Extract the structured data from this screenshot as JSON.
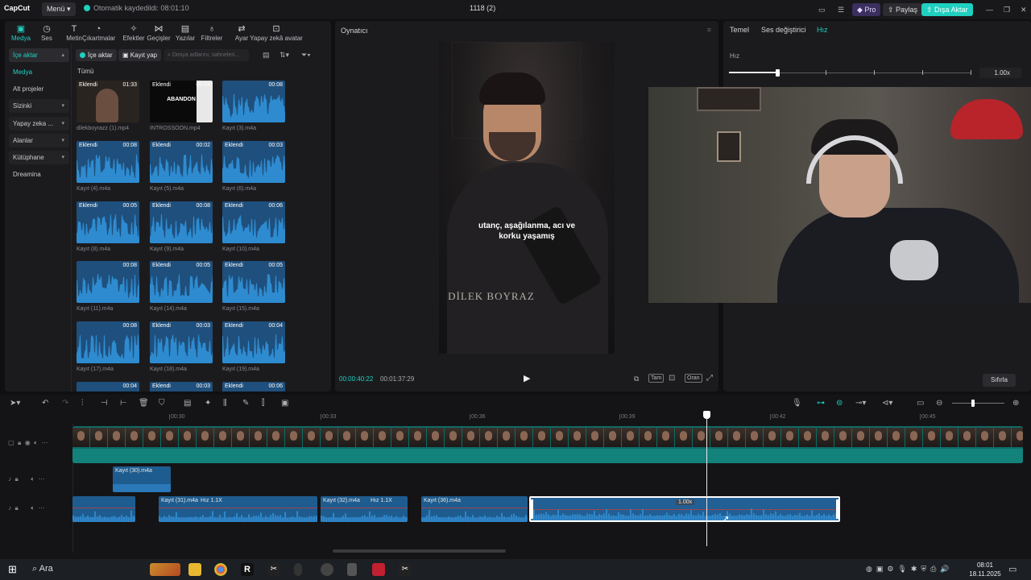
{
  "app": {
    "logo": "CapCut",
    "menu_label": "Menü",
    "autosave": "Otomatik kaydedildi: 08:01:10",
    "project_title": "1118 (2)",
    "pro_label": "Pro",
    "share_label": "Paylaş",
    "export_label": "Dışa Aktar"
  },
  "toolbar": {
    "tools": [
      {
        "label": "Medya",
        "icon": "media-icon"
      },
      {
        "label": "Ses",
        "icon": "audio-icon"
      },
      {
        "label": "Metin",
        "icon": "text-icon"
      },
      {
        "label": "Çıkartmalar",
        "icon": "sticker-icon"
      },
      {
        "label": "Efektler",
        "icon": "effects-icon"
      },
      {
        "label": "Geçişler",
        "icon": "transitions-icon"
      },
      {
        "label": "Yazılar",
        "icon": "captions-icon"
      },
      {
        "label": "Filtreler",
        "icon": "filters-icon"
      },
      {
        "label": "Ayar",
        "icon": "adjust-icon"
      },
      {
        "label": "Yapay zekâ avatar",
        "icon": "ai-avatar-icon"
      }
    ]
  },
  "sidebar": {
    "items": [
      {
        "label": "İçe aktar",
        "chevron": true
      },
      {
        "label": "Medya",
        "chevron": false
      },
      {
        "label": "Alt projeler",
        "chevron": false
      },
      {
        "label": "Sizinki",
        "chevron": true
      },
      {
        "label": "Yapay zeka ...",
        "chevron": true
      },
      {
        "label": "Alanlar",
        "chevron": true
      },
      {
        "label": "Kütüphane",
        "chevron": true
      },
      {
        "label": "Dreamina",
        "chevron": false
      }
    ]
  },
  "media": {
    "import_label": "İçe aktar",
    "record_label": "Kayıt yap",
    "search_placeholder": "Dosya adlarını, sahneleri...",
    "all_label": "Tümü",
    "items": [
      {
        "name": "dilekboyrazz (1).mp4",
        "tag": "Eklendi",
        "duration": "01:33",
        "kind": "video"
      },
      {
        "name": "INTROSSOON.mp4",
        "tag": "Eklendi",
        "duration": "00:04",
        "kind": "abandon",
        "overlay": "ABANDON"
      },
      {
        "name": "Kayıt (3).m4a",
        "tag": "",
        "duration": "00:08",
        "kind": "audio"
      },
      {
        "name": "Kayıt (4).m4a",
        "tag": "Eklendi",
        "duration": "00:08",
        "kind": "audio"
      },
      {
        "name": "Kayıt (5).m4a",
        "tag": "Eklendi",
        "duration": "00:02",
        "kind": "audio"
      },
      {
        "name": "Kayıt (6).m4a",
        "tag": "Eklendi",
        "duration": "00:03",
        "kind": "audio"
      },
      {
        "name": "Kayıt (8).m4a",
        "tag": "Eklendi",
        "duration": "00:05",
        "kind": "audio"
      },
      {
        "name": "Kayıt (9).m4a",
        "tag": "Eklendi",
        "duration": "00:08",
        "kind": "audio"
      },
      {
        "name": "Kayıt (10).m4a",
        "tag": "Eklendi",
        "duration": "00:06",
        "kind": "audio"
      },
      {
        "name": "Kayıt (11).m4a",
        "tag": "",
        "duration": "00:08",
        "kind": "audio"
      },
      {
        "name": "Kayıt (14).m4a",
        "tag": "Eklendi",
        "duration": "00:05",
        "kind": "audio"
      },
      {
        "name": "Kayıt (15).m4a",
        "tag": "Eklendi",
        "duration": "00:05",
        "kind": "audio"
      },
      {
        "name": "Kayıt (17).m4a",
        "tag": "",
        "duration": "00:08",
        "kind": "audio"
      },
      {
        "name": "Kayıt (18).m4a",
        "tag": "Eklendi",
        "duration": "00:03",
        "kind": "audio"
      },
      {
        "name": "Kayıt (19).m4a",
        "tag": "Eklendi",
        "duration": "00:04",
        "kind": "audio"
      },
      {
        "name": "",
        "tag": "",
        "duration": "00:04",
        "kind": "audio"
      },
      {
        "name": "",
        "tag": "Eklendi",
        "duration": "00:03",
        "kind": "audio"
      },
      {
        "name": "",
        "tag": "Eklendi",
        "duration": "00:06",
        "kind": "audio"
      }
    ]
  },
  "player": {
    "title": "Oynatıcı",
    "subtitle_line1": "utanç, aşağılanma, acı ve",
    "subtitle_line2": "korku yaşamış",
    "watermark": "DİLEK BOYRAZ",
    "current_time": "00:00:40:22",
    "total_time": "00:01:37:29",
    "full_label": "Tam",
    "ratio_label": "Oran"
  },
  "props": {
    "tabs": [
      "Temel",
      "Ses değiştirici",
      "Hız"
    ],
    "active_tab": 2,
    "speed_label": "Hız",
    "speed_value": "1.00x",
    "speed_slider_fraction": 0.2,
    "reset_label": "Sıfırla"
  },
  "timeline": {
    "ticks": [
      "00:30",
      "00:33",
      "00:36",
      "00:39",
      "00:42",
      "00:45"
    ],
    "clips_track2": [
      {
        "label": "Kayıt (30).m4a"
      }
    ],
    "clips_track3": [
      {
        "label": "",
        "speed": ""
      },
      {
        "label": "Kayıt (31).m4a",
        "speed": "Hız 1.1X"
      },
      {
        "label": "Kayıt (32).m4a",
        "speed": "Hız 1.1X"
      },
      {
        "label": "Kayıt (36).m4a",
        "speed": ""
      },
      {
        "label": "",
        "speed": "1.00x"
      }
    ]
  },
  "taskbar": {
    "search_label": "Ara",
    "time": "08:01",
    "date": "18.11.2025"
  },
  "colors": {
    "accent": "#1fd0c0",
    "audio_clip": "#1e5c8f",
    "video_track": "#0f6b66"
  }
}
